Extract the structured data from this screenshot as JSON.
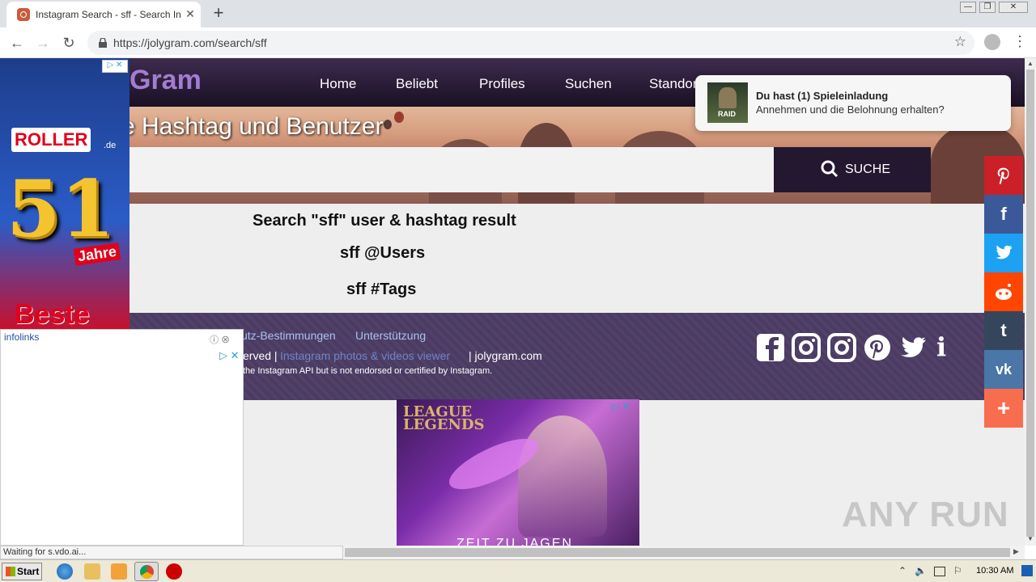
{
  "browser": {
    "tab_title": "Instagram Search - sff - Search In",
    "tab_close": "✕",
    "new_tab": "+",
    "url": "https://jolygram.com/search/sff",
    "window_buttons": [
      "—",
      "❐",
      "✕"
    ]
  },
  "site": {
    "logo": "Gram",
    "nav": [
      "Home",
      "Beliebt",
      "Profiles",
      "Suchen",
      "Standort"
    ],
    "hero_title": "e Hashtag und Benutzer",
    "search_button": "SUCHE",
    "results_heading": "Search \"sff\" user & hashtag result",
    "users_heading": "sff @Users",
    "tags_heading": "sff #Tags",
    "footer": {
      "link1": "utz-Bestimmungen",
      "link2": "Unterstützung",
      "rights_prefix": "erved |",
      "viewer_link": "Instagram photos & videos viewer",
      "site_name": "| jolygram.com",
      "disclaimer": "the Instagram API but is not endorsed or certified by Instagram."
    }
  },
  "notification": {
    "image_text": "RAID",
    "title": "Du hast (1) Spieleinladung",
    "body": "Annehmen und die Belohnung erhalten?"
  },
  "ads": {
    "left": {
      "brand": "ROLLER",
      "domain": ".de",
      "big_number": "51",
      "jahre": "Jahre",
      "beste": "Beste"
    },
    "infolinks_label": "infolinks",
    "lol_logo_line1": "LEAGUE",
    "lol_logo_line2": "LEGENDS",
    "lol_tagline": "ZEIT ZU JAGEN"
  },
  "share_bar": [
    {
      "name": "pinterest",
      "glyph": "P",
      "color": "#cb2027"
    },
    {
      "name": "facebook",
      "glyph": "f",
      "color": "#3b5998"
    },
    {
      "name": "twitter",
      "glyph": "t",
      "color": "#1da1f2"
    },
    {
      "name": "reddit",
      "glyph": "r",
      "color": "#ff4500"
    },
    {
      "name": "tumblr",
      "glyph": "t",
      "color": "#35465c"
    },
    {
      "name": "vk",
      "glyph": "vk",
      "color": "#4a76a8"
    },
    {
      "name": "more",
      "glyph": "+",
      "color": "#f96d4f"
    }
  ],
  "status_text": "Waiting for s.vdo.ai...",
  "watermark": "ANY RUN",
  "taskbar": {
    "start": "Start",
    "time": "10:30 AM"
  }
}
